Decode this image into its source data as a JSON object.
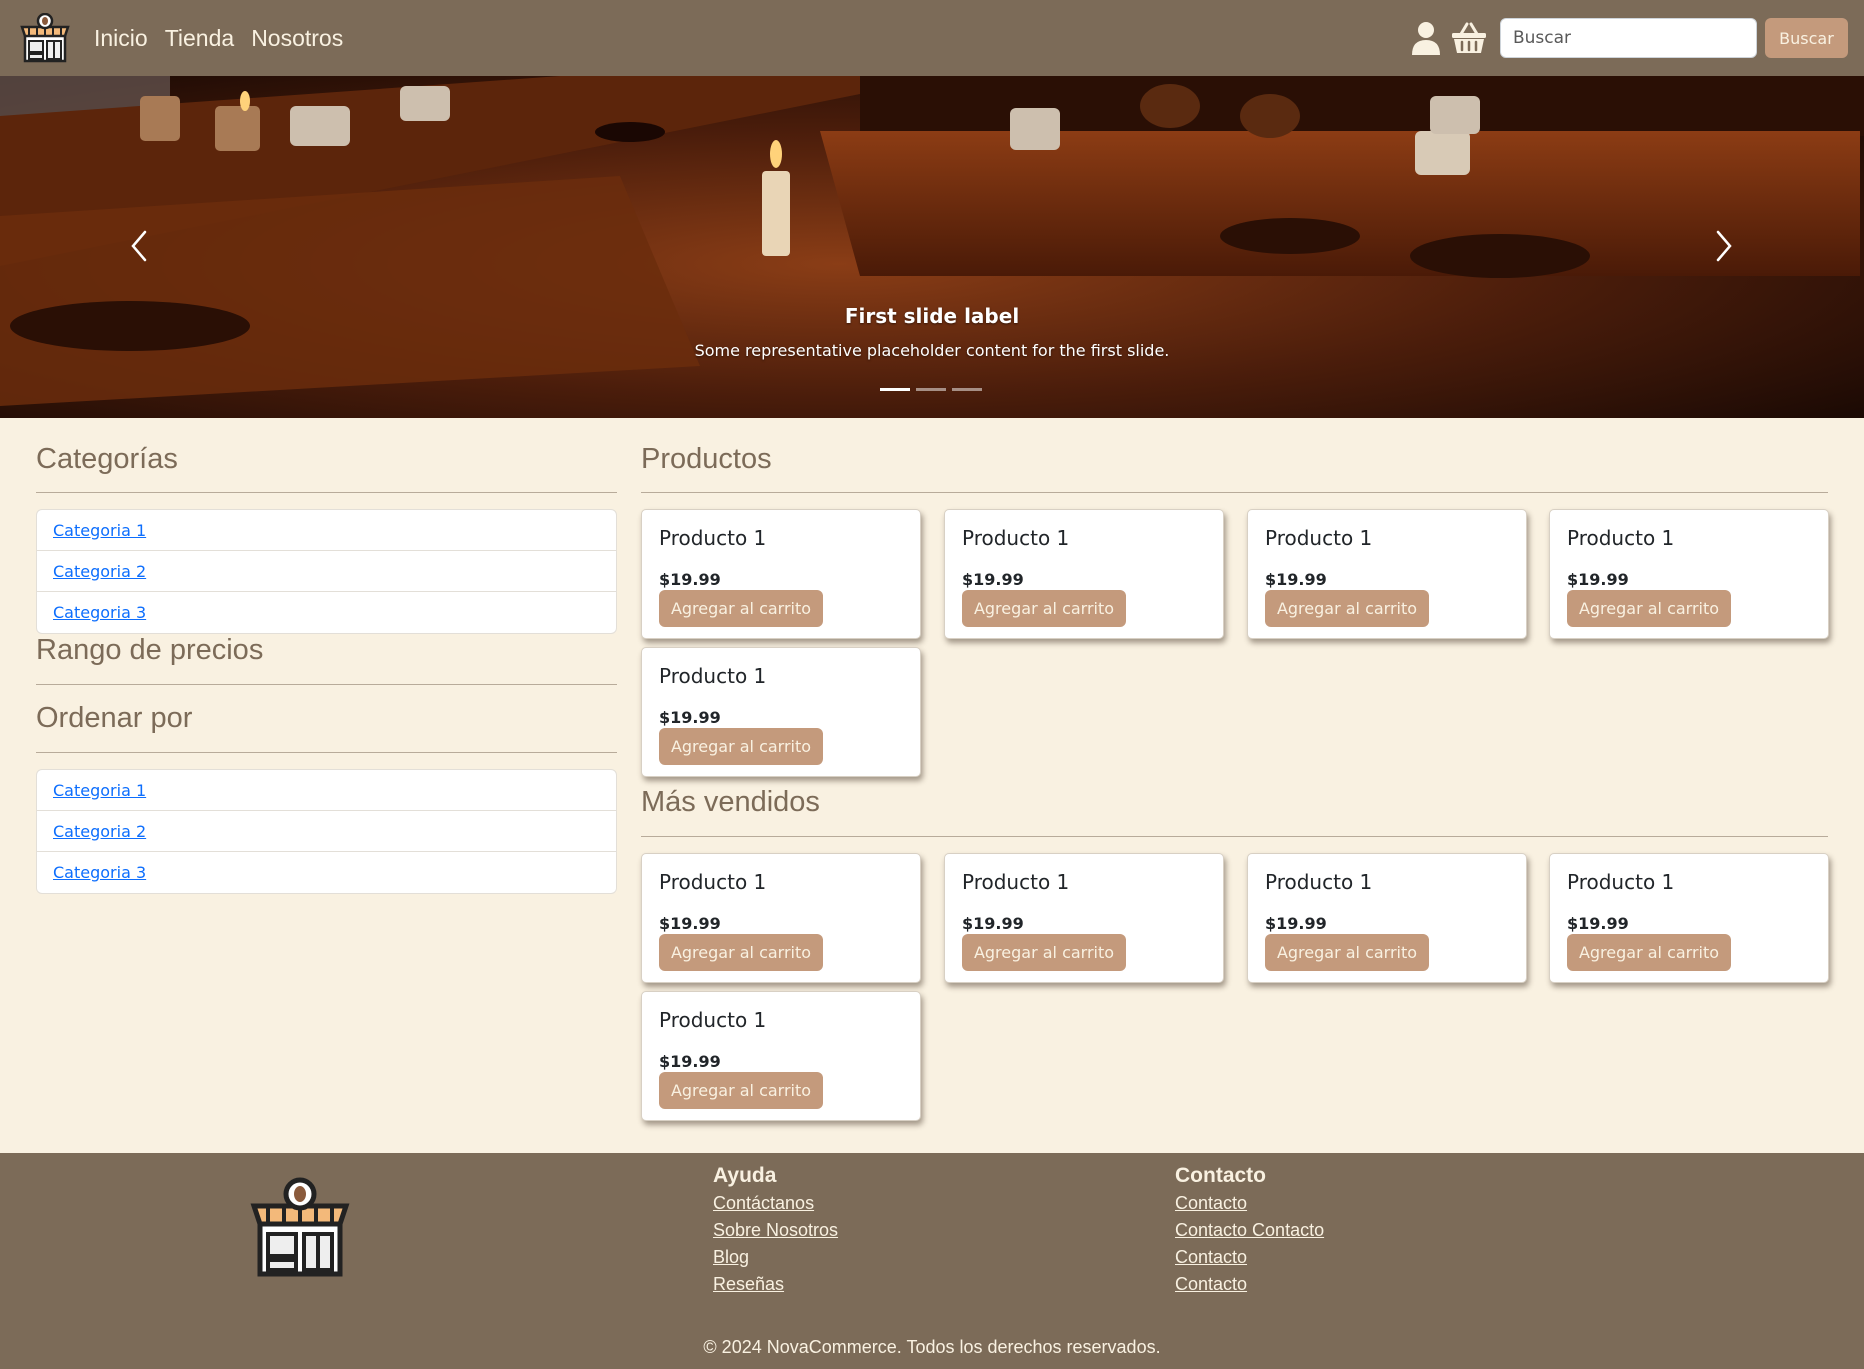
{
  "navbar": {
    "links": [
      "Inicio",
      "Tienda",
      "Nosotros"
    ],
    "icons": [
      "user-icon",
      "basket-icon"
    ],
    "search_placeholder": "Buscar",
    "search_button": "Buscar"
  },
  "hero": {
    "title": "First slide label",
    "text": "Some representative placeholder content for the first slide.",
    "slides": 3,
    "active_slide": 1
  },
  "sidebar": {
    "categories_title": "Categorías",
    "categories": [
      "Categoria 1",
      "Categoria 2",
      "Categoria 3"
    ],
    "price_range_title": "Rango de precios",
    "sort_title": "Ordenar por",
    "sort_options": [
      "Categoria 1",
      "Categoria 2",
      "Categoria 3"
    ]
  },
  "products": {
    "title": "Productos",
    "items": [
      {
        "name": "Producto 1",
        "price": "$19.99",
        "button": "Agregar al carrito"
      },
      {
        "name": "Producto 1",
        "price": "$19.99",
        "button": "Agregar al carrito"
      },
      {
        "name": "Producto 1",
        "price": "$19.99",
        "button": "Agregar al carrito"
      },
      {
        "name": "Producto 1",
        "price": "$19.99",
        "button": "Agregar al carrito"
      },
      {
        "name": "Producto 1",
        "price": "$19.99",
        "button": "Agregar al carrito"
      }
    ]
  },
  "bestsellers": {
    "title": "Más vendidos",
    "items": [
      {
        "name": "Producto 1",
        "price": "$19.99",
        "button": "Agregar al carrito"
      },
      {
        "name": "Producto 1",
        "price": "$19.99",
        "button": "Agregar al carrito"
      },
      {
        "name": "Producto 1",
        "price": "$19.99",
        "button": "Agregar al carrito"
      },
      {
        "name": "Producto 1",
        "price": "$19.99",
        "button": "Agregar al carrito"
      },
      {
        "name": "Producto 1",
        "price": "$19.99",
        "button": "Agregar al carrito"
      }
    ]
  },
  "footer": {
    "help_title": "Ayuda",
    "help_links": [
      "Contáctanos",
      "Sobre Nosotros",
      "Blog",
      "Reseñas"
    ],
    "contact_title": "Contacto",
    "contact_links": [
      "Contacto",
      "Contacto Contacto",
      "Contacto",
      "Contacto"
    ],
    "copyright": "© 2024 NovaCommerce. Todos los derechos reservados."
  },
  "colors": {
    "nav_bg": "#7c6b58",
    "page_bg": "#f9f1e1",
    "accent": "#c49a7c",
    "heading": "#7c6b58"
  }
}
